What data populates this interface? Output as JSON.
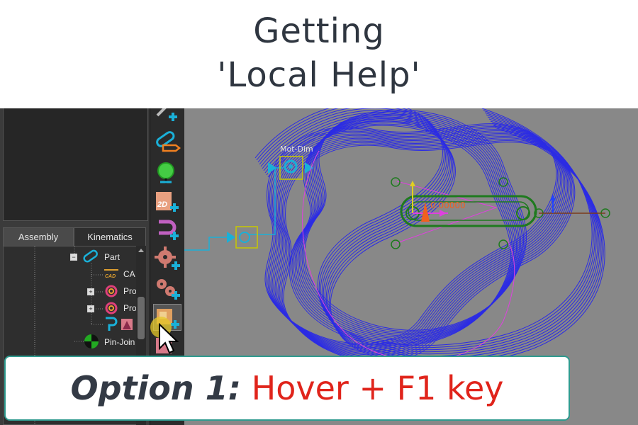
{
  "title": {
    "line1": "Getting",
    "line2": "'Local Help'"
  },
  "tabs": [
    {
      "label": "Assembly",
      "active": true
    },
    {
      "label": "Kinematics",
      "active": false
    }
  ],
  "tree": [
    {
      "label": "Part",
      "icon": "part-link-icon",
      "expander": "−"
    },
    {
      "label": "CA",
      "icon": "cad-icon",
      "expander": ""
    },
    {
      "label": "Pro",
      "icon": "property-ring-icon",
      "expander": "+"
    },
    {
      "label": "Pro",
      "icon": "property-ring-icon",
      "expander": "+"
    },
    {
      "label": "",
      "icon": "pin-shape-icon",
      "expander": ""
    },
    {
      "label": "Pin-Join",
      "icon": "pin-joint-icon",
      "expander": ""
    }
  ],
  "toolbar": [
    "add-link-icon",
    "add-part-link-icon",
    "add-center-of-mass-icon",
    "add-2d-part-icon",
    "add-magnet-icon",
    "add-gear-icon",
    "add-gear-pair-icon",
    "add-shape-icon",
    "add-shape-2-icon"
  ],
  "viewport": {
    "motion_dimension_label": "Mot-Dim",
    "angle_value": "0.00000"
  },
  "callout": {
    "option": "Option 1:",
    "action": "Hover + F1 key"
  },
  "colors": {
    "accent_red": "#e0241b",
    "callout_border": "#2f9b8f",
    "curve_blue": "#2222ee",
    "toolbar_cyan": "#1ab0d8",
    "part_green": "#1e7a1e"
  }
}
